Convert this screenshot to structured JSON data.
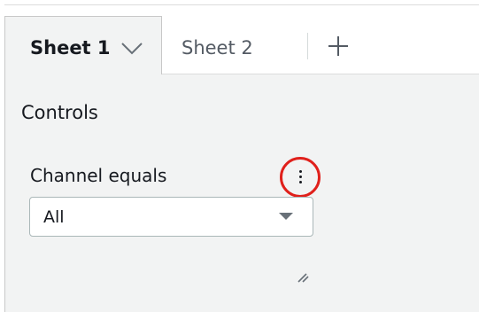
{
  "tabs": [
    {
      "label": "Sheet 1",
      "active": true
    },
    {
      "label": "Sheet 2",
      "active": false
    }
  ],
  "icons": {
    "tab_menu": "chevron-down-icon",
    "add_tab": "plus-icon",
    "control_menu": "more-vertical-icon",
    "dropdown": "caret-down-icon",
    "resize": "resize-handle-icon"
  },
  "controls": {
    "heading": "Controls",
    "items": [
      {
        "label": "Channel equals",
        "value": "All"
      }
    ]
  },
  "colors": {
    "highlight": "#e0201b",
    "panel_background": "#f2f3f3",
    "text": "#16191f",
    "muted_text": "#545b64"
  }
}
